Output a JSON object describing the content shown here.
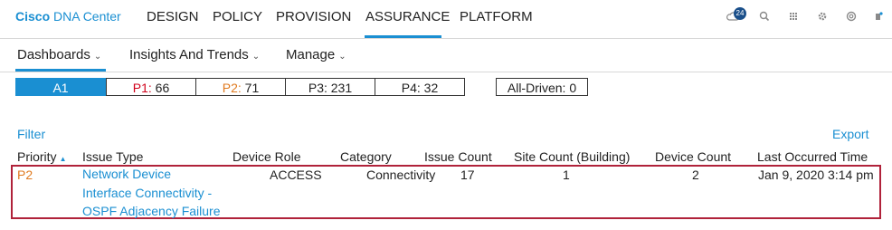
{
  "topnav": {
    "brand_bold": "Cisco",
    "brand_rest": " DNA Center",
    "items": [
      "DESIGN",
      "POLICY",
      "PROVISION",
      "ASSURANCE",
      "PLATFORM"
    ],
    "notification_count": "24"
  },
  "subnav": {
    "items": [
      "Dashboards",
      "Insights And Trends",
      "Manage"
    ]
  },
  "priority_filters": {
    "a1": "A1",
    "p1_label": "P1:",
    "p1_count": " 66",
    "p2_label": "P2:",
    "p2_count": " 71",
    "p3": "P3: 231",
    "p4": "P4: 32",
    "all_driven": "All-Driven: 0"
  },
  "colors": {
    "accent": "#1a8fd2",
    "p1": "#d0021b",
    "p2": "#e07a1f",
    "highlight": "#b0223a"
  },
  "table": {
    "filter": "Filter",
    "export": "Export",
    "columns": [
      "Priority",
      "Issue Type",
      "Device Role",
      "Category",
      "Issue Count",
      "Site Count (Building)",
      "Device Count",
      "Last Occurred Time"
    ],
    "row": {
      "priority": "P2",
      "issue_type_lines": [
        "Network Device",
        "Interface Connectivity -",
        "OSPF Adjacency Failure"
      ],
      "device_role": "ACCESS",
      "category": "Connectivity",
      "issue_count": "17",
      "site_count": "1",
      "device_count": "2",
      "last_occurred": "Jan 9, 2020 3:14 pm"
    }
  }
}
